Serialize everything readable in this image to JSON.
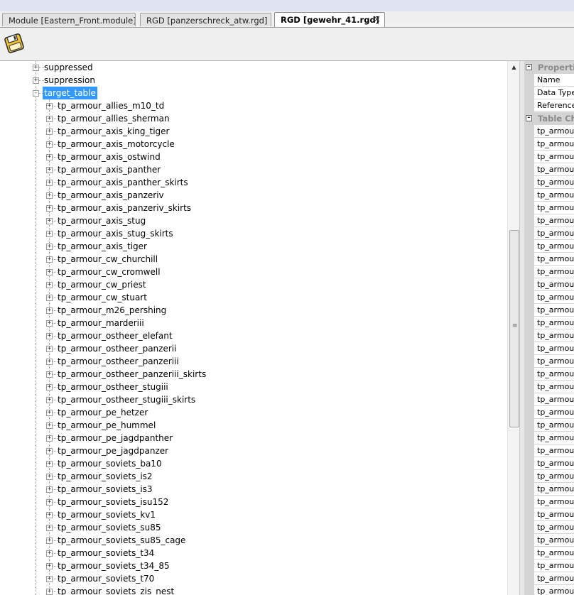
{
  "tabs": [
    {
      "label": "Module [Eastern_Front.module]",
      "active": false
    },
    {
      "label": "RGD [panzerschreck_atw.rgd]",
      "active": false
    },
    {
      "label": "RGD [gewehr_41.rgd]",
      "active": true
    }
  ],
  "tab_close_glyph": "×",
  "toolbar": {
    "save_icon": "floppy-disk-icon"
  },
  "tree": {
    "top_items": [
      {
        "label": "suppressed",
        "expander": "+"
      },
      {
        "label": "suppression",
        "expander": "+"
      },
      {
        "label": "target_table",
        "expander": "-",
        "selected": true
      }
    ],
    "children": [
      "tp_armour_allies_m10_td",
      "tp_armour_allies_sherman",
      "tp_armour_axis_king_tiger",
      "tp_armour_axis_motorcycle",
      "tp_armour_axis_ostwind",
      "tp_armour_axis_panther",
      "tp_armour_axis_panther_skirts",
      "tp_armour_axis_panzeriv",
      "tp_armour_axis_panzeriv_skirts",
      "tp_armour_axis_stug",
      "tp_armour_axis_stug_skirts",
      "tp_armour_axis_tiger",
      "tp_armour_cw_churchill",
      "tp_armour_cw_cromwell",
      "tp_armour_cw_priest",
      "tp_armour_cw_stuart",
      "tp_armour_m26_pershing",
      "tp_armour_marderiii",
      "tp_armour_ostheer_elefant",
      "tp_armour_ostheer_panzerii",
      "tp_armour_ostheer_panzeriii",
      "tp_armour_ostheer_panzeriii_skirts",
      "tp_armour_ostheer_stugiii",
      "tp_armour_ostheer_stugiii_skirts",
      "tp_armour_pe_hetzer",
      "tp_armour_pe_hummel",
      "tp_armour_pe_jagdpanther",
      "tp_armour_pe_jagdpanzer",
      "tp_armour_soviets_ba10",
      "tp_armour_soviets_is2",
      "tp_armour_soviets_is3",
      "tp_armour_soviets_isu152",
      "tp_armour_soviets_kv1",
      "tp_armour_soviets_su85",
      "tp_armour_soviets_su85_cage",
      "tp_armour_soviets_t34",
      "tp_armour_soviets_t34_85",
      "tp_armour_soviets_t70",
      "tp_armour_soviets_zis_nest"
    ],
    "child_expander": "+"
  },
  "scrollbar": {
    "up_arrow": "▲",
    "grip": "≡"
  },
  "properties": {
    "category_glyph": "-",
    "cat1": "Properties",
    "cat1_rows": [
      "Name",
      "Data Type",
      "Reference"
    ],
    "cat2": "Table Children",
    "cat2_row_label": "tp_armour_",
    "cat2_row_count": 37
  }
}
